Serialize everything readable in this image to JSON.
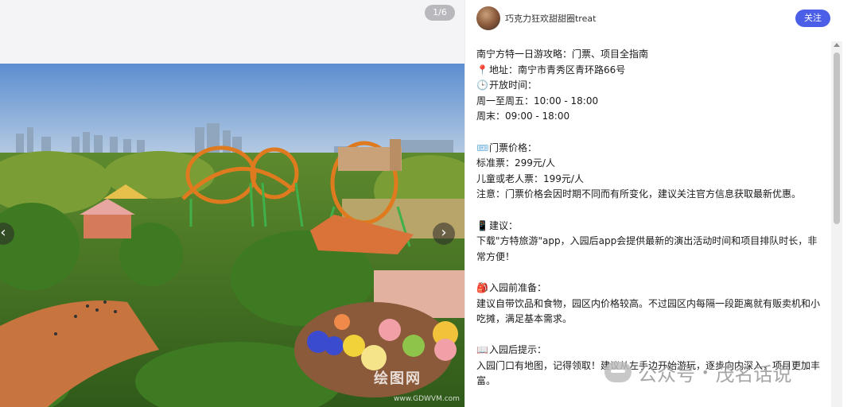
{
  "image": {
    "counter": "1/6",
    "site_watermark": "绘图网",
    "site_url": "www.GDWVM.com"
  },
  "nav": {
    "prev_label": "‹",
    "next_label": "›"
  },
  "author": {
    "name": "巧克力狂欢甜甜圈treat",
    "follow_label": "关注"
  },
  "note": {
    "title": "南宁方特一日游攻略：门票、项目全指南",
    "address": "地址：南宁市青秀区青环路66号",
    "hours_heading": "开放时间：",
    "weekday_hours": "周一至周五：10:00 - 18:00",
    "weekend_hours": "周末：09:00 - 18:00",
    "tickets_heading": "门票价格：",
    "standard_ticket": "标准票：299元/人",
    "child_ticket": "儿童或老人票：199元/人",
    "ticket_note": "注意：门票价格会因时期不同而有所变化，建议关注官方信息获取最新优惠。",
    "tips_heading": "建议：",
    "tips_text": "下载\"方特旅游\"app，入园后app会提供最新的演出活动时间和项目排队时长，非常方便！",
    "prep_heading": "入园前准备：",
    "prep_text": "建议自带饮品和食物，园区内价格较高。不过园区内每隔一段距离就有贩卖机和小吃摊，满足基本需求。",
    "entry_heading": "入园后提示：",
    "entry_text": "入园门口有地图，记得领取！建议从左手边开始游玩，逐步向内深入，项目更加丰富。"
  },
  "watermark": {
    "account": "公众号",
    "name": "茂名话说"
  },
  "icons": {
    "address": "round-pushpin-icon",
    "hours": "clock-icon",
    "tickets": "ticket-icon",
    "tips": "mobile-phone-icon",
    "prep": "backpack-icon",
    "entry": "open-book-icon"
  },
  "colors": {
    "follow_button": "#4a5ee8",
    "panel_bg": "#ffffff",
    "media_bg": "#f4f4f6"
  }
}
